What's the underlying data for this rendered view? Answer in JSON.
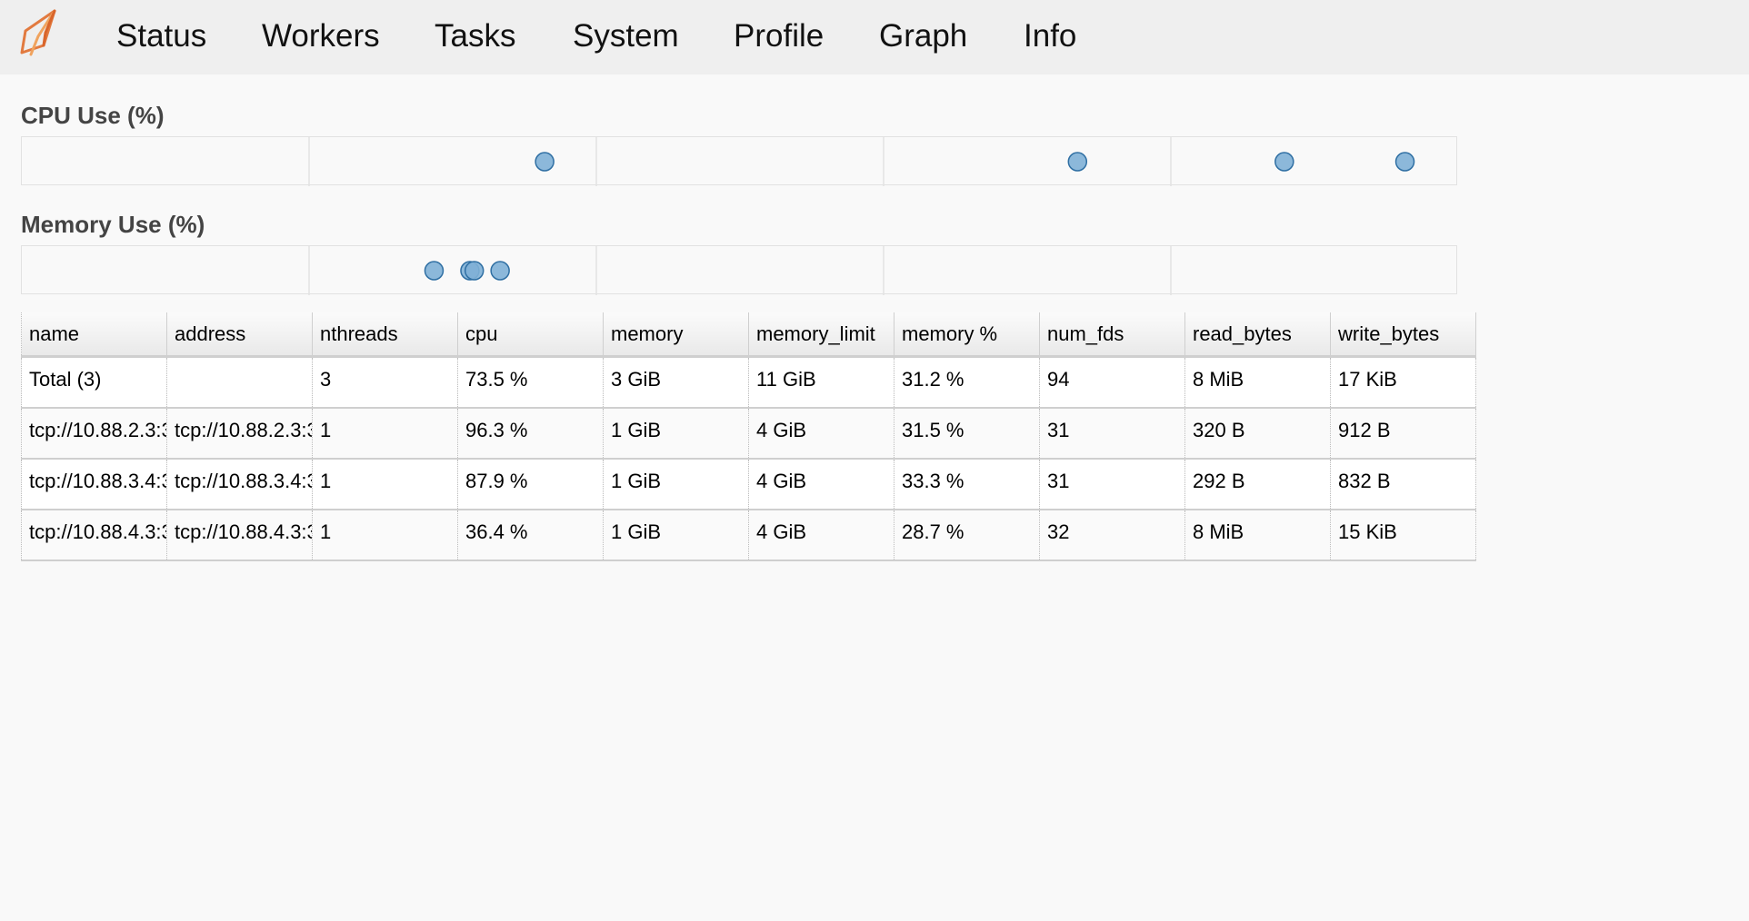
{
  "nav": {
    "logo_name": "dask-logo",
    "items": [
      {
        "label": "Status"
      },
      {
        "label": "Workers"
      },
      {
        "label": "Tasks"
      },
      {
        "label": "System"
      },
      {
        "label": "Profile"
      },
      {
        "label": "Graph"
      },
      {
        "label": "Info"
      }
    ]
  },
  "cpu_section": {
    "title": "CPU Use (%)",
    "range": [
      0,
      100
    ],
    "points": [
      73.5,
      96.3,
      87.9,
      36.4
    ],
    "point_color": "#7fb0d6",
    "point_stroke": "#2f6fa3"
  },
  "memory_section": {
    "title": "Memory Use (%)",
    "range": [
      0,
      100
    ],
    "points": [
      31.2,
      31.5,
      33.3,
      28.7
    ],
    "point_color": "#7fb0d6",
    "point_stroke": "#2f6fa3"
  },
  "table": {
    "columns": [
      "name",
      "address",
      "nthreads",
      "cpu",
      "memory",
      "memory_limit",
      "memory %",
      "num_fds",
      "read_bytes",
      "write_bytes"
    ],
    "rows": [
      [
        "Total (3)",
        "",
        "3",
        "73.5 %",
        "3 GiB",
        "11 GiB",
        "31.2 %",
        "94",
        "8 MiB",
        "17 KiB"
      ],
      [
        "tcp://10.88.2.3:3",
        "tcp://10.88.2.3:3",
        "1",
        "96.3 %",
        "1 GiB",
        "4 GiB",
        "31.5 %",
        "31",
        "320 B",
        "912 B"
      ],
      [
        "tcp://10.88.3.4:3",
        "tcp://10.88.3.4:3",
        "1",
        "87.9 %",
        "1 GiB",
        "4 GiB",
        "33.3 %",
        "31",
        "292 B",
        "832 B"
      ],
      [
        "tcp://10.88.4.3:3",
        "tcp://10.88.4.3:3",
        "1",
        "36.4 %",
        "1 GiB",
        "4 GiB",
        "28.7 %",
        "32",
        "8 MiB",
        "15 KiB"
      ]
    ]
  }
}
